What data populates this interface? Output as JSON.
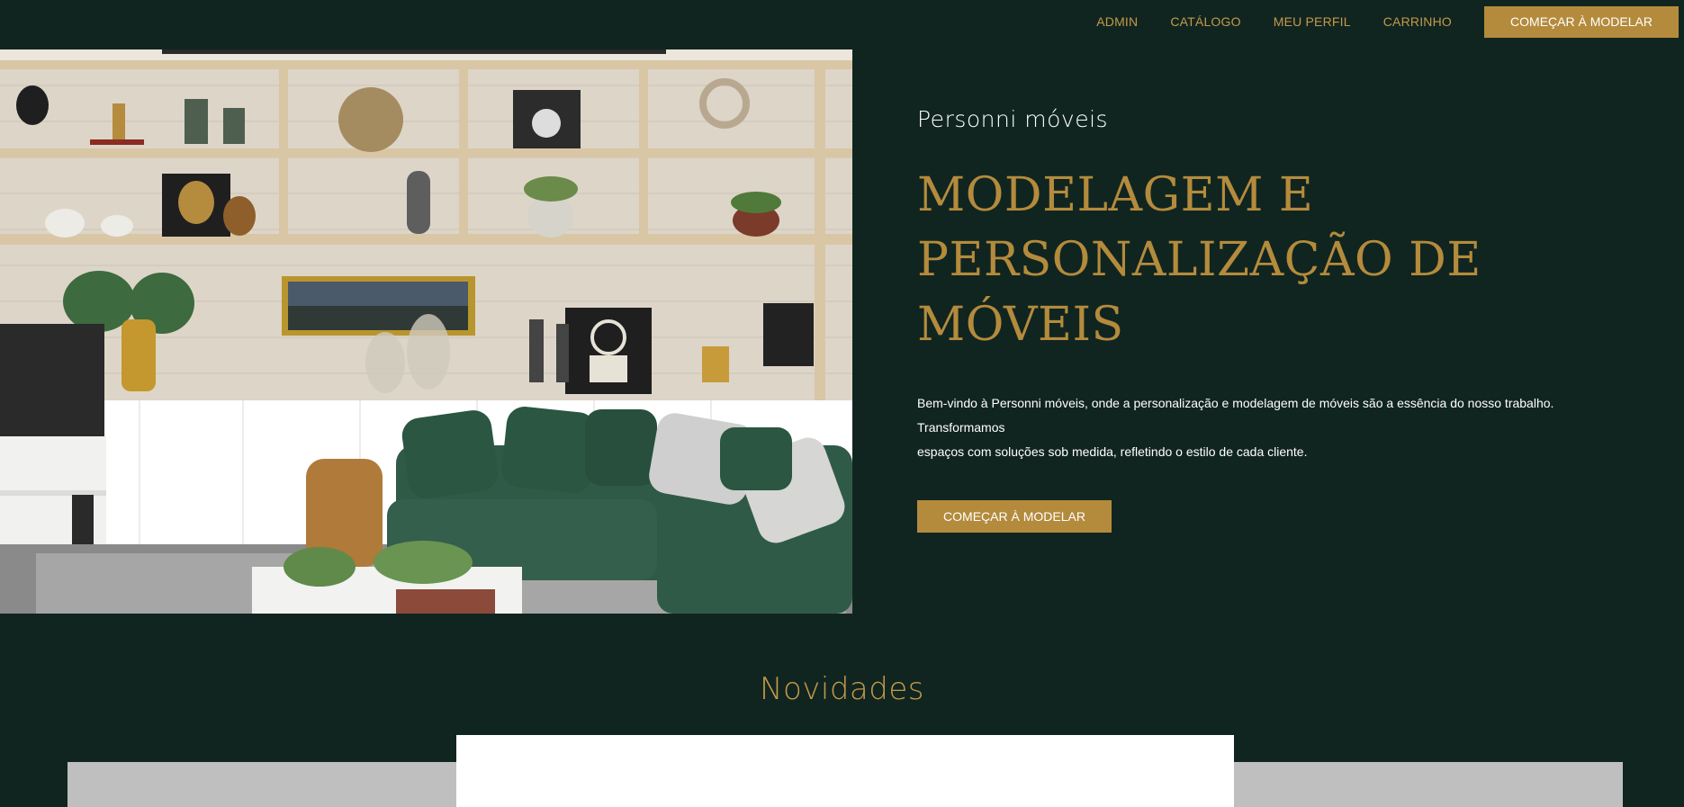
{
  "nav": {
    "links": [
      "ADMIN",
      "CATÁLOGO",
      "MEU PERFIL",
      "CARRINHO"
    ],
    "cta_label": "COMEÇAR À MODELAR"
  },
  "hero": {
    "brand": "Personni móveis",
    "headline_line1": "MODELAGEM E",
    "headline_line2": "PERSONALIZAÇÃO DE MÓVEIS",
    "intro_line1": "Bem-vindo à Personni móveis, onde a personalização e modelagem de móveis são a essência do nosso trabalho. Transformamos",
    "intro_line2": "espaços com soluções sob medida, refletindo o estilo de cada cliente.",
    "cta_label": "COMEÇAR À MODELAR"
  },
  "news": {
    "title": "Novidades"
  },
  "colors": {
    "background": "#112520",
    "accent": "#b48b3c",
    "text_light": "#ffffff"
  }
}
